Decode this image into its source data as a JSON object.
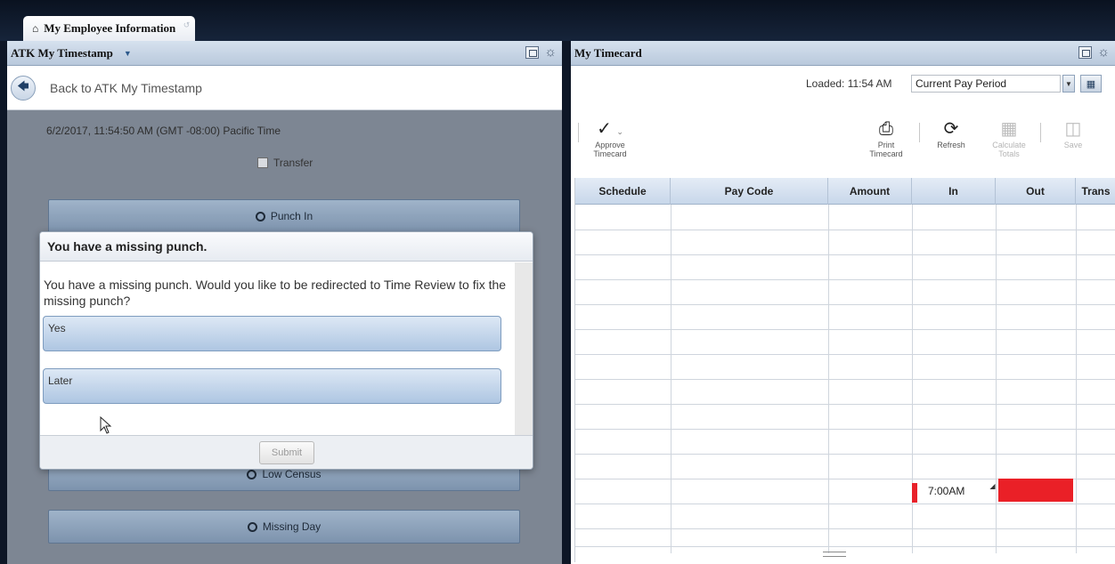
{
  "app_tab": {
    "label": "My Employee Information"
  },
  "left_panel": {
    "title": "ATK My Timestamp",
    "back_label": "Back to ATK My Timestamp",
    "datetime": "6/2/2017, 11:54:50 AM (GMT -08:00) Pacific Time",
    "transfer_label": "Transfer",
    "buttons": {
      "punch_in": "Punch In",
      "low_census": "Low Census",
      "missing_day": "Missing Day"
    }
  },
  "modal": {
    "title": "You have a missing punch.",
    "message": "You have a missing punch. Would you like to be redirected to Time Review to fix the missing punch?",
    "options": [
      "Yes",
      "Later"
    ],
    "submit_label": "Submit"
  },
  "right_panel": {
    "title": "My Timecard",
    "loaded_text": "Loaded: 11:54 AM",
    "period_select": "Current Pay Period",
    "toolbar": {
      "approve": [
        "Approve",
        "Timecard"
      ],
      "print": [
        "Print",
        "Timecard"
      ],
      "refresh": "Refresh",
      "calculate": [
        "Calculate",
        "Totals"
      ],
      "save": "Save"
    },
    "columns": [
      "Schedule",
      "Pay Code",
      "Amount",
      "In",
      "Out",
      "Trans"
    ],
    "in_punch_time": "7:00AM"
  },
  "colors": {
    "missing_punch": "#ea2027",
    "header_gradient": "#c8d7ea",
    "overlay_gray": "#7d8693"
  },
  "icons": [
    "home-icon",
    "back-arrow-icon",
    "clock-icon",
    "check-icon",
    "print-icon",
    "refresh-icon",
    "calculator-icon",
    "save-icon",
    "gear-icon",
    "maximize-icon",
    "calendar-icon"
  ]
}
